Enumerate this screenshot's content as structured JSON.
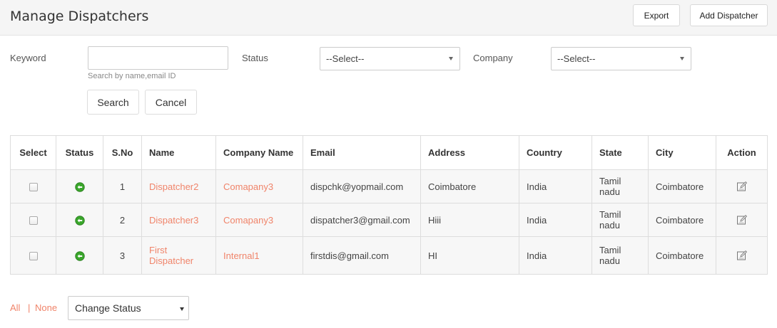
{
  "header": {
    "title": "Manage Dispatchers",
    "export_label": "Export",
    "add_label": "Add Dispatcher"
  },
  "filters": {
    "keyword_label": "Keyword",
    "keyword_value": "",
    "keyword_hint": "Search by name,email ID",
    "status_label": "Status",
    "status_selected": "--Select--",
    "company_label": "Company",
    "company_selected": "--Select--",
    "search_label": "Search",
    "cancel_label": "Cancel"
  },
  "table": {
    "headers": {
      "select": "Select",
      "status": "Status",
      "sno": "S.No",
      "name": "Name",
      "company": "Company Name",
      "email": "Email",
      "address": "Address",
      "country": "Country",
      "state": "State",
      "city": "City",
      "action": "Action"
    },
    "rows": [
      {
        "sno": "1",
        "name": "Dispatcher2",
        "company": "Comapany3",
        "email": "dispchk@yopmail.com",
        "address": "Coimbatore",
        "country": "India",
        "state": "Tamil nadu",
        "city": "Coimbatore"
      },
      {
        "sno": "2",
        "name": "Dispatcher3",
        "company": "Comapany3",
        "email": "dispatcher3@gmail.com",
        "address": "Hiii",
        "country": "India",
        "state": "Tamil nadu",
        "city": "Coimbatore"
      },
      {
        "sno": "3",
        "name": "First Dispatcher",
        "company": "Internal1",
        "email": "firstdis@gmail.com",
        "address": "HI",
        "country": "India",
        "state": "Tamil nadu",
        "city": "Coimbatore"
      }
    ],
    "status_icon": "active-green-icon",
    "action_icon": "edit-icon"
  },
  "footer": {
    "all_label": "All",
    "separator": "|",
    "none_label": "None",
    "change_status_selected": "Change Status"
  },
  "colors": {
    "accent_link": "#f0846a",
    "status_green": "#3aa62b"
  }
}
